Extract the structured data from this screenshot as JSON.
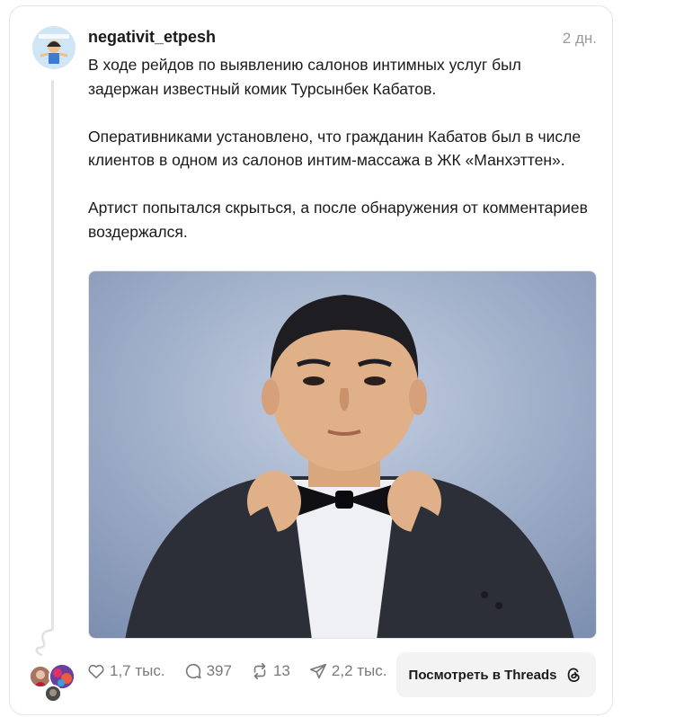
{
  "post": {
    "username": "negativit_etpesh",
    "time": "2 дн.",
    "paragraphs": [
      "В ходе рейдов по выявлению салонов интимных услуг был задержан известный комик Турсынбек Кабатов.",
      "Оперативниками установлено, что гражданин Кабатов был в числе клиентов в одном из салонов интим-массажа в ЖК «Манхэттен».",
      "Артист попытался скрыться, а после обнаружения от комментариев воздержался."
    ]
  },
  "actions": {
    "likes": "1,7 тыс.",
    "comments": "397",
    "reposts": "13",
    "shares": "2,2 тыс."
  },
  "open_button": {
    "label": "Посмотреть в Threads"
  },
  "icons": [
    "heart-icon",
    "comment-icon",
    "repost-icon",
    "share-icon",
    "threads-logo-icon"
  ],
  "colors": {
    "muted": "#7a7a7a",
    "button_bg": "#f3f3f3",
    "photo_bg": "#8fa1bf"
  }
}
